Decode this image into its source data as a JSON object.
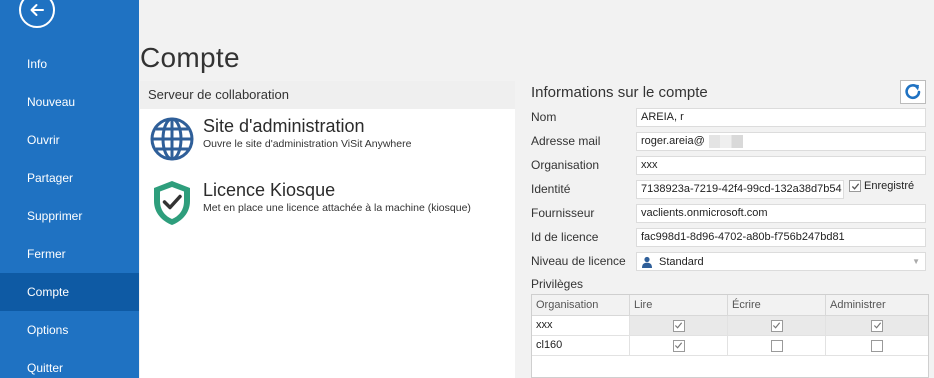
{
  "sidebar": {
    "back_icon": "arrow-left-icon",
    "items": [
      {
        "label": "Info",
        "active": false
      },
      {
        "label": "Nouveau",
        "active": false
      },
      {
        "label": "Ouvrir",
        "active": false
      },
      {
        "label": "Partager",
        "active": false
      },
      {
        "label": "Supprimer",
        "active": false
      },
      {
        "label": "Fermer",
        "active": false
      },
      {
        "label": "Compte",
        "active": true
      },
      {
        "label": "Options",
        "active": false
      },
      {
        "label": "Quitter",
        "active": false
      }
    ],
    "bg_color": "#1f72c2",
    "active_color": "#0e5aa4"
  },
  "page": {
    "title": "Compte"
  },
  "collab": {
    "header": "Serveur de collaboration",
    "actions": [
      {
        "title": "Site d'administration",
        "desc": "Ouvre le site d'administration ViSit Anywhere",
        "icon": "globe-icon"
      },
      {
        "title": "Licence Kiosque",
        "desc": "Met en place une licence attachée à la machine (kiosque)",
        "icon": "shield-check-icon"
      }
    ]
  },
  "account": {
    "title": "Informations sur le compte",
    "refresh_icon": "refresh-icon",
    "fields": {
      "nom": {
        "label": "Nom",
        "value": "AREIA, r"
      },
      "mail": {
        "label": "Adresse mail",
        "value": "roger.areia@"
      },
      "org": {
        "label": "Organisation",
        "value": "xxx"
      },
      "identite": {
        "label": "Identité",
        "value": "7138923a-7219-42f4-99cd-132a38d7b54"
      },
      "fournisseur": {
        "label": "Fournisseur",
        "value": "vaclients.onmicrosoft.com"
      },
      "licence_id": {
        "label": "Id de licence",
        "value": "fac998d1-8d96-4702-a80b-f756b247bd81"
      },
      "niveau": {
        "label": "Niveau de licence",
        "value": "Standard"
      }
    },
    "registered": {
      "label": "Enregistré",
      "checked": true
    },
    "privileges": {
      "label": "Privilèges",
      "columns": [
        "Organisation",
        "Lire",
        "Écrire",
        "Administrer"
      ],
      "rows": [
        {
          "org": "xxx",
          "lire": true,
          "ecrire": true,
          "admin": true,
          "selected": true
        },
        {
          "org": "cl160",
          "lire": true,
          "ecrire": false,
          "admin": false,
          "selected": false
        }
      ]
    }
  }
}
